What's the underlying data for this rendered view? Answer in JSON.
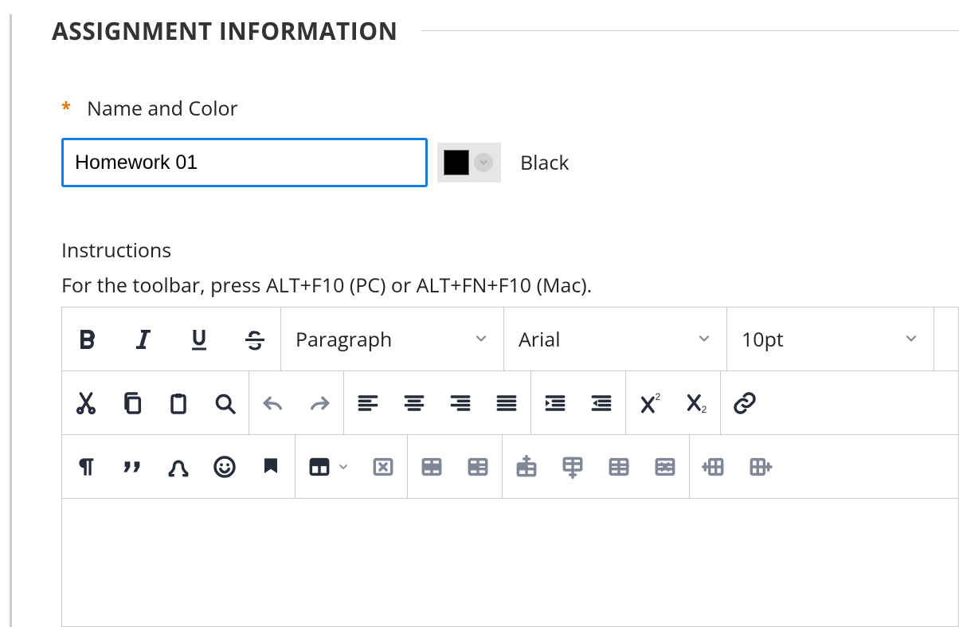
{
  "section": {
    "title": "ASSIGNMENT INFORMATION"
  },
  "name": {
    "required_marker": "*",
    "label": "Name and Color",
    "value": "Homework 01",
    "color_name": "Black",
    "color_hex": "#000000"
  },
  "instructions": {
    "label": "Instructions",
    "help": "For the toolbar, press ALT+F10 (PC) or ALT+FN+F10 (Mac)."
  },
  "toolbar": {
    "format_dd": "Paragraph",
    "font_dd": "Arial",
    "size_dd": "10pt"
  }
}
